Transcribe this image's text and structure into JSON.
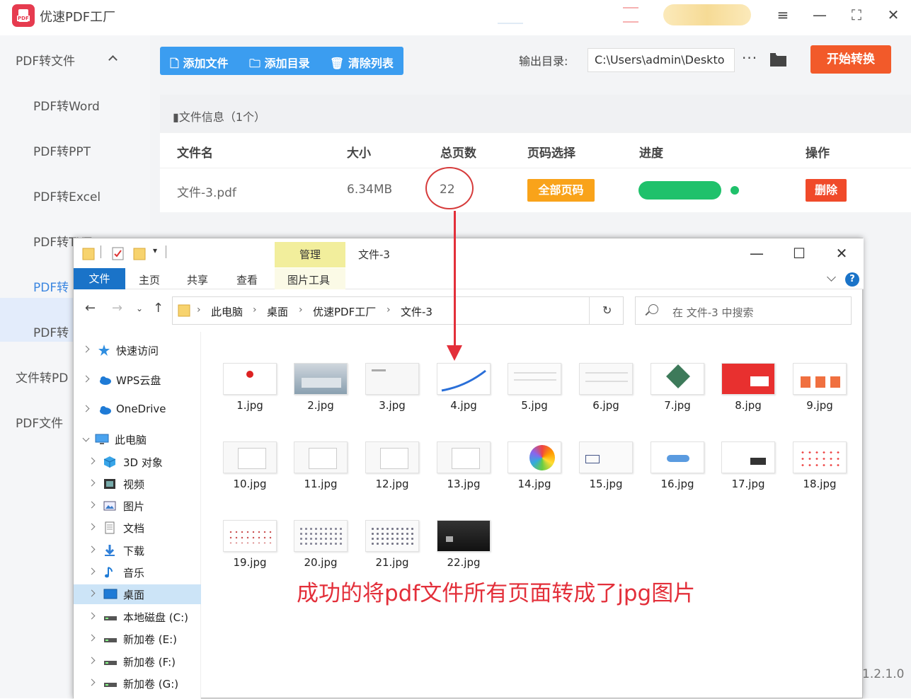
{
  "app": {
    "title": "优速PDF工厂",
    "logo_text": "PDF",
    "version": "1.2.1.0",
    "window_controls": [
      "≡",
      "—",
      "⛶",
      "✕"
    ]
  },
  "sidebar": {
    "items": [
      {
        "label": "PDF转文件"
      },
      {
        "label": "PDF转Word"
      },
      {
        "label": "PDF转PPT"
      },
      {
        "label": "PDF转Excel"
      },
      {
        "label": "PDF转TXT"
      },
      {
        "label": "PDF转"
      },
      {
        "label": "PDF转"
      },
      {
        "label": "文件转PD"
      },
      {
        "label": "PDF文件"
      }
    ]
  },
  "toolbar": {
    "add_file": "添加文件",
    "add_dir": "添加目录",
    "clear_list": "清除列表",
    "output_label": "输出目录:",
    "output_path": "C:\\Users\\admin\\Deskto",
    "more": "···",
    "start": "开始转换"
  },
  "table": {
    "info": "文件信息（1个）",
    "headers": [
      "文件名",
      "大小",
      "总页数",
      "页码选择",
      "进度",
      "操作"
    ],
    "row": {
      "name": "文件-3.pdf",
      "size": "6.34MB",
      "pages": "22",
      "page_select": "全部页码",
      "progress": 1.0,
      "action": "删除"
    }
  },
  "explorer": {
    "title": "文件-3",
    "manage": "管理",
    "tabs": [
      "文件",
      "主页",
      "共享",
      "查看",
      "图片工具"
    ],
    "address": [
      "此电脑",
      "桌面",
      "优速PDF工厂",
      "文件-3"
    ],
    "search_placeholder": "在 文件-3 中搜索",
    "tree": [
      {
        "label": "快速访问",
        "icon": "star-icon"
      },
      {
        "label": "WPS云盘",
        "icon": "cloud-icon"
      },
      {
        "label": "OneDrive",
        "icon": "cloud-icon"
      },
      {
        "label": "此电脑",
        "icon": "computer-icon"
      },
      {
        "label": "3D 对象",
        "icon": "cube-icon"
      },
      {
        "label": "视频",
        "icon": "video-icon"
      },
      {
        "label": "图片",
        "icon": "picture-icon"
      },
      {
        "label": "文档",
        "icon": "document-icon"
      },
      {
        "label": "下载",
        "icon": "download-icon"
      },
      {
        "label": "音乐",
        "icon": "music-icon"
      },
      {
        "label": "桌面",
        "icon": "desktop-icon"
      },
      {
        "label": "本地磁盘 (C:)",
        "icon": "drive-icon"
      },
      {
        "label": "新加卷 (E:)",
        "icon": "drive-icon"
      },
      {
        "label": "新加卷 (F:)",
        "icon": "drive-icon"
      },
      {
        "label": "新加卷 (G:)",
        "icon": "drive-icon"
      }
    ],
    "files": [
      "1.jpg",
      "2.jpg",
      "3.jpg",
      "4.jpg",
      "5.jpg",
      "6.jpg",
      "7.jpg",
      "8.jpg",
      "9.jpg",
      "10.jpg",
      "11.jpg",
      "12.jpg",
      "13.jpg",
      "14.jpg",
      "15.jpg",
      "16.jpg",
      "17.jpg",
      "18.jpg",
      "19.jpg",
      "20.jpg",
      "21.jpg",
      "22.jpg"
    ]
  },
  "annotation": {
    "text": "成功的将pdf文件所有页面转成了jpg图片",
    "color": "#e32f3a"
  }
}
